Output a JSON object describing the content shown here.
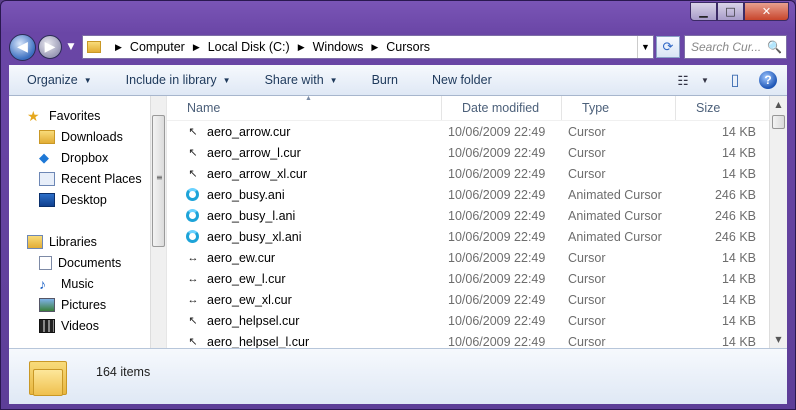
{
  "window": {
    "caption_buttons": {
      "minimize": "▁",
      "maximize": "□",
      "close": "✕"
    }
  },
  "nav": {
    "back_icon": "◀",
    "forward_icon": "▶",
    "dropdown_icon": "▼"
  },
  "address": {
    "crumbs": [
      "Computer",
      "Local Disk (C:)",
      "Windows",
      "Cursors"
    ],
    "separator": "▶",
    "dropdown": "▼",
    "refresh_icon": "⟳"
  },
  "search": {
    "placeholder": "Search Cur...",
    "icon": "🔍"
  },
  "toolbar": {
    "organize": "Organize",
    "include_in_library": "Include in library",
    "share_with": "Share with",
    "burn": "Burn",
    "new_folder": "New folder",
    "views_icon": "☷",
    "views_caret": "▼",
    "preview_icon": "▯",
    "help": "?",
    "caret": "▼"
  },
  "navpane": {
    "favorites": {
      "label": "Favorites",
      "items": [
        "Downloads",
        "Dropbox",
        "Recent Places",
        "Desktop"
      ]
    },
    "libraries": {
      "label": "Libraries",
      "items": [
        "Documents",
        "Music",
        "Pictures",
        "Videos"
      ]
    },
    "scroll_grip": "≡"
  },
  "columns": {
    "name": "Name",
    "date": "Date modified",
    "type": "Type",
    "size": "Size",
    "sort_arrow": "▲"
  },
  "files": [
    {
      "name": "aero_arrow.cur",
      "date": "10/06/2009 22:49",
      "type": "Cursor",
      "size": "14 KB",
      "icon": "↖"
    },
    {
      "name": "aero_arrow_l.cur",
      "date": "10/06/2009 22:49",
      "type": "Cursor",
      "size": "14 KB",
      "icon": "↖"
    },
    {
      "name": "aero_arrow_xl.cur",
      "date": "10/06/2009 22:49",
      "type": "Cursor",
      "size": "14 KB",
      "icon": "↖"
    },
    {
      "name": "aero_busy.ani",
      "date": "10/06/2009 22:49",
      "type": "Animated Cursor",
      "size": "246 KB",
      "icon": "busy"
    },
    {
      "name": "aero_busy_l.ani",
      "date": "10/06/2009 22:49",
      "type": "Animated Cursor",
      "size": "246 KB",
      "icon": "busy"
    },
    {
      "name": "aero_busy_xl.ani",
      "date": "10/06/2009 22:49",
      "type": "Animated Cursor",
      "size": "246 KB",
      "icon": "busy"
    },
    {
      "name": "aero_ew.cur",
      "date": "10/06/2009 22:49",
      "type": "Cursor",
      "size": "14 KB",
      "icon": "↔"
    },
    {
      "name": "aero_ew_l.cur",
      "date": "10/06/2009 22:49",
      "type": "Cursor",
      "size": "14 KB",
      "icon": "↔"
    },
    {
      "name": "aero_ew_xl.cur",
      "date": "10/06/2009 22:49",
      "type": "Cursor",
      "size": "14 KB",
      "icon": "↔"
    },
    {
      "name": "aero_helpsel.cur",
      "date": "10/06/2009 22:49",
      "type": "Cursor",
      "size": "14 KB",
      "icon": "↖"
    },
    {
      "name": "aero_helpsel_l.cur",
      "date": "10/06/2009 22:49",
      "type": "Cursor",
      "size": "14 KB",
      "icon": "↖"
    }
  ],
  "scrollbar": {
    "up": "▲",
    "down": "▼"
  },
  "details": {
    "count": "164 items"
  }
}
